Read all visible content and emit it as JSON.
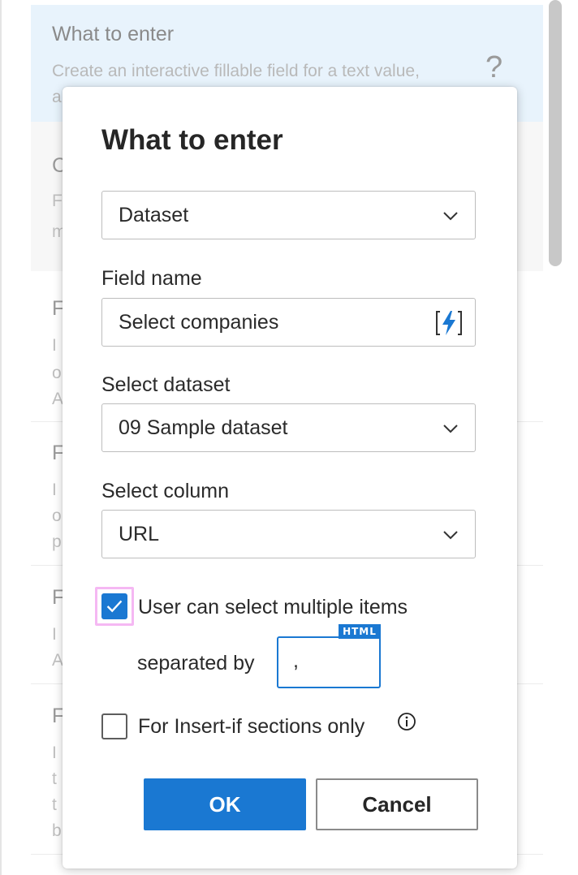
{
  "background": {
    "selected_card": {
      "title": "What to enter",
      "description": "Create an interactive fillable field for a text value,",
      "description_cont": "a"
    },
    "card2": {
      "letter": "C",
      "sub1": "F",
      "sub2": "m"
    },
    "card3": {
      "letter": "F",
      "sub1": "I",
      "sub2": "o",
      "sub3": "A"
    },
    "card4": {
      "letter": "F",
      "sub1": "I",
      "sub2": "o",
      "sub3": "p"
    },
    "card5": {
      "letter": "F",
      "sub1": "I",
      "sub2": "A"
    },
    "card6": {
      "letter": "F",
      "sub1": "I",
      "sub2": "t",
      "sub3": "t",
      "sub4": "b"
    },
    "help_glyph": "?"
  },
  "dialog": {
    "title": "What to enter",
    "type_select": {
      "value": "Dataset"
    },
    "field_name": {
      "label": "Field name",
      "value": "Select companies"
    },
    "dataset": {
      "label": "Select dataset",
      "value": "09 Sample dataset"
    },
    "column": {
      "label": "Select column",
      "value": "URL"
    },
    "multiple": {
      "checked": true,
      "label": "User can select multiple items",
      "separated_label": "separated by",
      "separator_value": ",",
      "badge": "HTML"
    },
    "insert_if": {
      "checked": false,
      "label": "For Insert-if sections only"
    },
    "ok_label": "OK",
    "cancel_label": "Cancel"
  },
  "colors": {
    "accent": "#1a78d2",
    "focus_ring": "#f5b8f3",
    "selected_card_bg": "#e8f3fc"
  },
  "icons": {
    "dropdown": "chevron-down-icon",
    "dynamic_value": "lightning-bolt-icon",
    "check": "checkmark-icon",
    "info": "info-icon"
  }
}
